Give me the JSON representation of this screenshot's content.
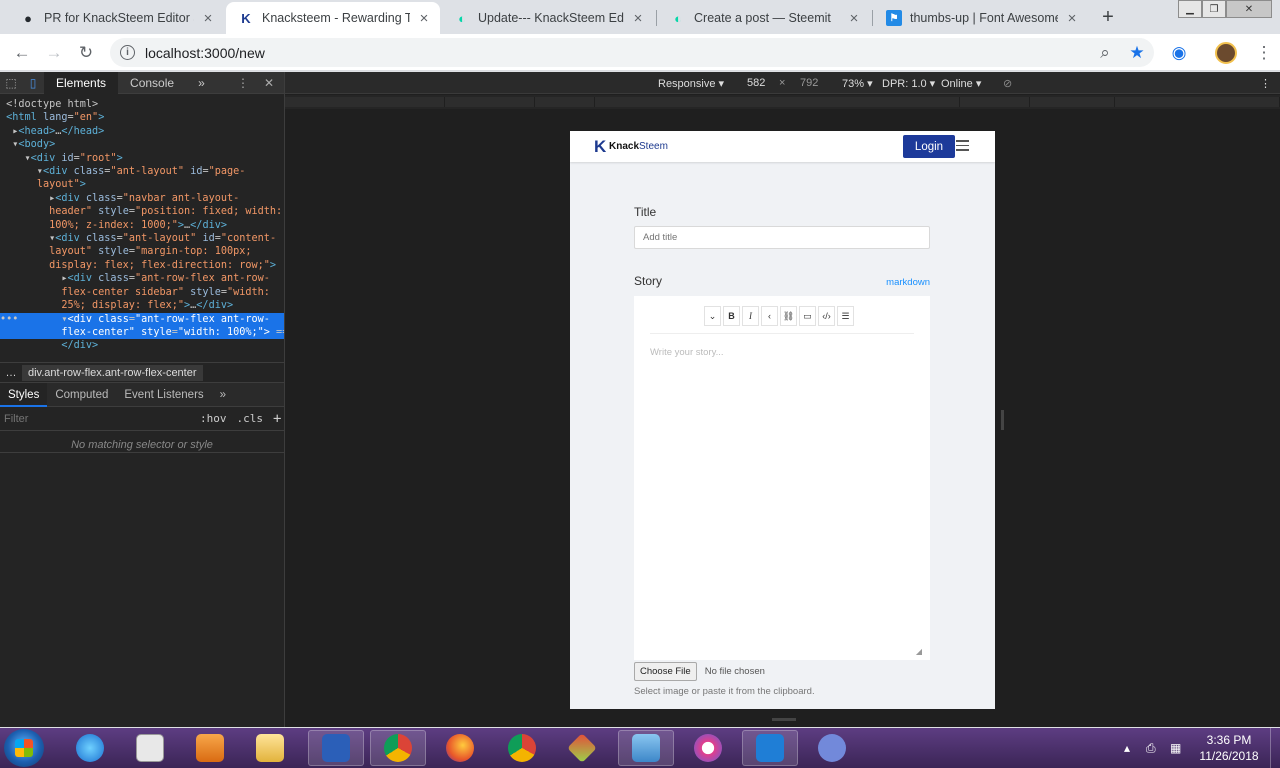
{
  "tabs": [
    {
      "title": "PR for KnackSteem Editor and",
      "close": "×"
    },
    {
      "title": "Knacksteem - Rewarding Tal",
      "close": "×"
    },
    {
      "title": "Update--- KnackSteem Edito",
      "close": "×"
    },
    {
      "title": "Create a post — Steemit",
      "close": "×"
    },
    {
      "title": "thumbs-up | Font Awesome",
      "close": "×"
    }
  ],
  "new_tab": "+",
  "address": {
    "url": "localhost:3000/new"
  },
  "devtools": {
    "tab_elements": "Elements",
    "tab_console": "Console",
    "more": "»",
    "crumb_node": "div.ant-row-flex.ant-row-flex-center",
    "styles_tab": "Styles",
    "computed_tab": "Computed",
    "listeners_tab": "Event Listeners",
    "filter_placeholder": "Filter",
    "hov": ":hov",
    "cls": ".cls",
    "plus": "+",
    "no_match": "No matching selector or style"
  },
  "emulation": {
    "mode": "Responsive ▾",
    "width": "582",
    "times": "×",
    "height": "792",
    "zoom": "73% ▾",
    "dpr": "DPR: 1.0 ▾",
    "network": "Online ▾"
  },
  "page": {
    "brand_bold": "Knack",
    "brand_rest": "Steem",
    "login": "Login",
    "title_label": "Title",
    "title_placeholder": "Add title",
    "story_label": "Story",
    "markdown": "markdown",
    "toolbar_buttons": [
      "⌄",
      "B",
      "I",
      "‹",
      "🔗",
      "▭",
      "‹/›",
      "☰"
    ],
    "story_placeholder": "Write your story...",
    "choose_file": "Choose File",
    "no_file": "No file chosen",
    "hint": "Select image or paste it from the clipboard."
  },
  "taskbar": {
    "time": "3:36 PM",
    "date": "11/26/2018"
  },
  "colors": {
    "login_button": "#1d3a9a",
    "markdown_link": "#1890ff",
    "devtools_selection": "#1a73e8"
  }
}
